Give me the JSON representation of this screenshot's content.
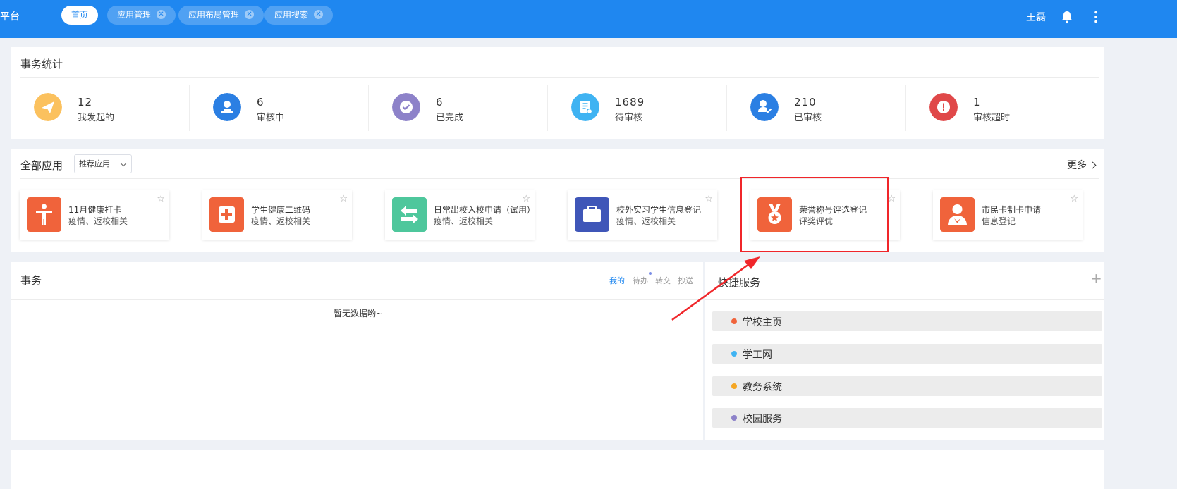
{
  "header": {
    "brand": "平台",
    "tabs": [
      {
        "label": "首页",
        "active": true,
        "closable": false
      },
      {
        "label": "应用管理",
        "active": false,
        "closable": true
      },
      {
        "label": "应用布局管理",
        "active": false,
        "closable": true
      },
      {
        "label": "应用搜索",
        "active": false,
        "closable": true
      }
    ],
    "user": "王磊",
    "icons": [
      "bell-icon",
      "more-vertical-icon"
    ],
    "color": "#1f87f0"
  },
  "stats": {
    "title": "事务统计",
    "items": [
      {
        "value": "12",
        "label": "我发起的",
        "icon": "paper-plane-icon",
        "color": "#fbc15e"
      },
      {
        "value": "6",
        "label": "审核中",
        "icon": "user-stamp-icon",
        "color": "#2b7fe3"
      },
      {
        "value": "6",
        "label": "已完成",
        "icon": "check-circle-icon",
        "color": "#8d82c9"
      },
      {
        "value": "1689",
        "label": "待审核",
        "icon": "document-icon",
        "color": "#3fb3f2"
      },
      {
        "value": "210",
        "label": "已审核",
        "icon": "user-check-icon",
        "color": "#2b7fe3"
      },
      {
        "value": "1",
        "label": "审核超时",
        "icon": "alert-icon",
        "color": "#e04849"
      }
    ]
  },
  "apps": {
    "title": "全部应用",
    "filter": "推荐应用",
    "more": "更多",
    "items": [
      {
        "name": "11月健康打卡",
        "desc": "疫情、返校相关",
        "icon": "person-icon",
        "color": "#f0633b"
      },
      {
        "name": "学生健康二维码",
        "desc": "疫情、返校相关",
        "icon": "medical-cross-icon",
        "color": "#f0633b"
      },
      {
        "name": "日常出校入校申请（试用）",
        "desc": "疫情、返校相关",
        "icon": "swap-arrows-icon",
        "color": "#4ec79c"
      },
      {
        "name": "校外实习学生信息登记",
        "desc": "疫情、返校相关",
        "icon": "briefcase-icon",
        "color": "#3f56b8"
      },
      {
        "name": "荣誉称号评选登记",
        "desc": "评奖评优",
        "icon": "medal-icon",
        "color": "#f0633b"
      },
      {
        "name": "市民卡制卡申请",
        "desc": "信息登记",
        "icon": "citizen-card-icon",
        "color": "#f0633b"
      }
    ],
    "highlight_color": "#f0262a"
  },
  "affairs": {
    "title": "事务",
    "tabs": [
      "我的",
      "待办",
      "转交",
      "抄送"
    ],
    "active_tab": "我的",
    "empty_text": "暂无数据哟~"
  },
  "quick_services": {
    "title": "快捷服务",
    "items": [
      {
        "label": "学校主页",
        "color": "#f0633b"
      },
      {
        "label": "学工网",
        "color": "#3fb3f2"
      },
      {
        "label": "教务系统",
        "color": "#f5a623"
      },
      {
        "label": "校园服务",
        "color": "#8d82c9"
      }
    ]
  }
}
